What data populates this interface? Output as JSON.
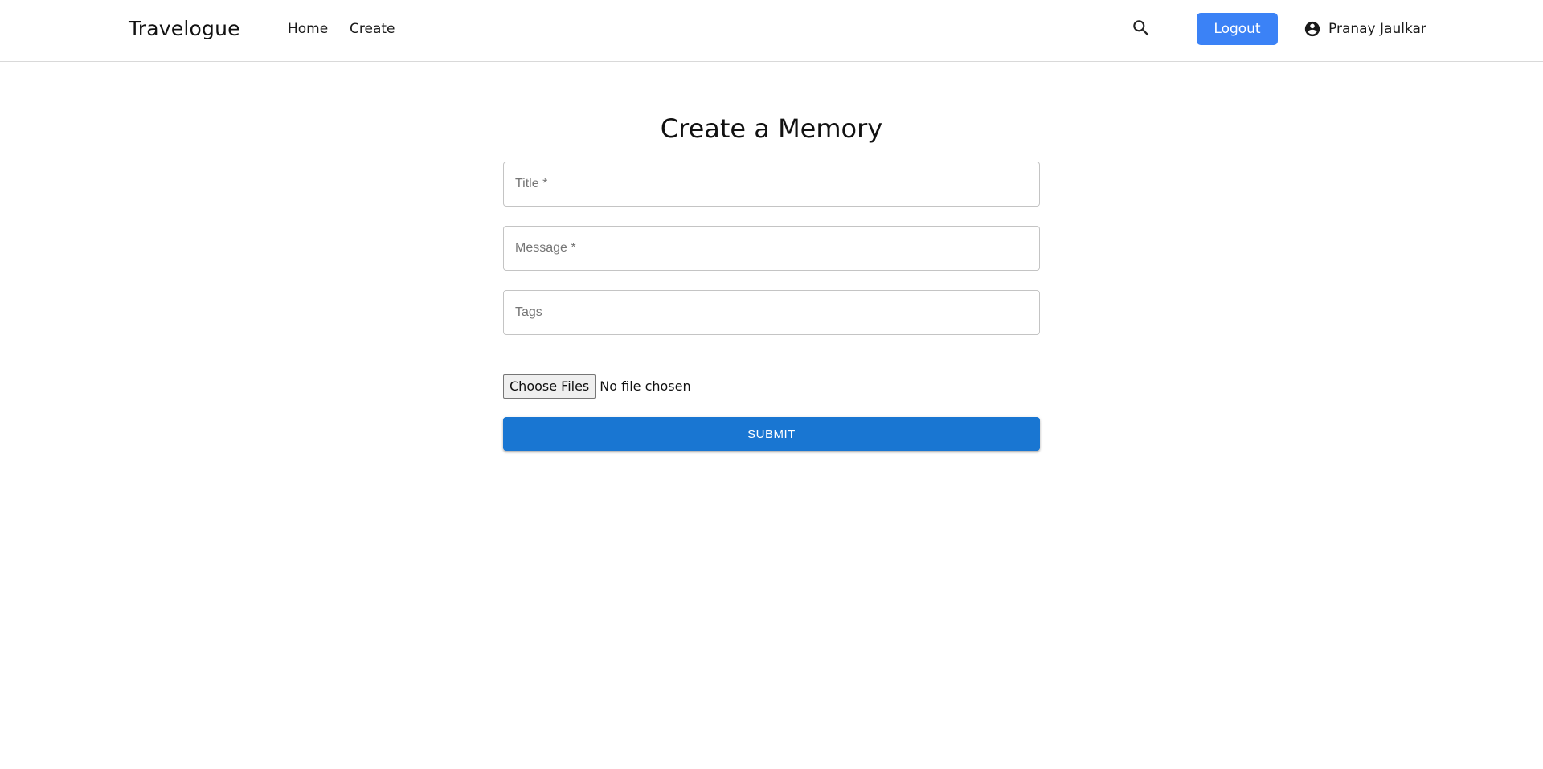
{
  "header": {
    "brand": "Travelogue",
    "nav": [
      {
        "label": "Home"
      },
      {
        "label": "Create"
      }
    ],
    "search_icon": "search-icon",
    "logout_label": "Logout",
    "user": {
      "icon": "account-circle-icon",
      "name": "Pranay Jaulkar"
    }
  },
  "form": {
    "title": "Create a Memory",
    "fields": {
      "title": {
        "placeholder": "Title *",
        "value": ""
      },
      "message": {
        "placeholder": "Message *",
        "value": ""
      },
      "tags": {
        "placeholder": "Tags",
        "value": ""
      }
    },
    "file": {
      "button_label": "Choose Files",
      "status": "No file chosen"
    },
    "submit_label": "SUBMIT"
  },
  "colors": {
    "logout_button": "#3b82f6",
    "submit_button": "#1976d2",
    "field_border": "#c4c4c4",
    "navbar_border": "#d9d9d9"
  }
}
